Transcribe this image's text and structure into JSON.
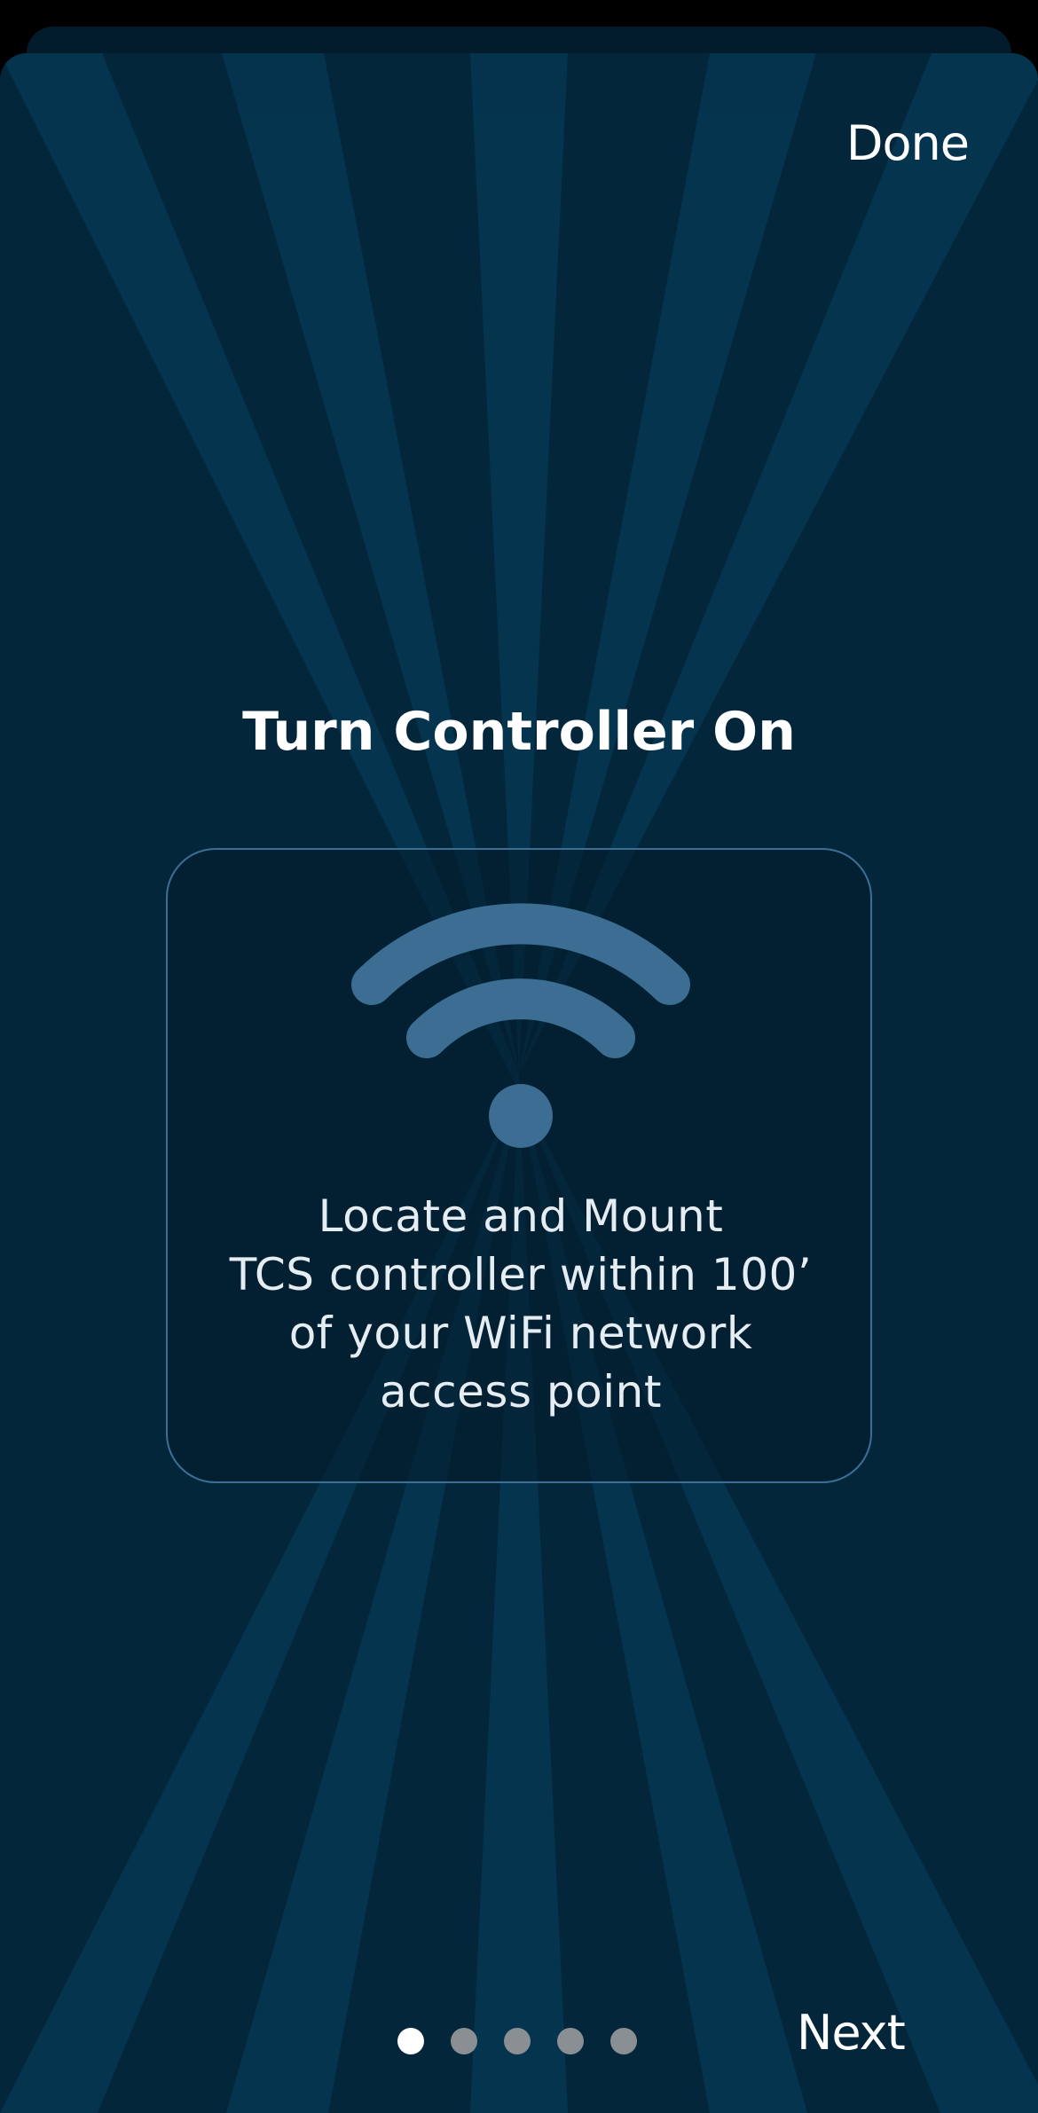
{
  "header": {
    "done_label": "Done"
  },
  "main": {
    "title": "Turn Controller On",
    "card": {
      "icon": "wifi-icon",
      "lines": [
        "Locate and Mount",
        "TCS controller within 100’",
        "of your WiFi network",
        "access point"
      ]
    }
  },
  "footer": {
    "page_count": 5,
    "current_page": 1,
    "next_label": "Next"
  },
  "colors": {
    "background": "#03263b",
    "ray": "#063651",
    "card_border": "#3d6f96",
    "icon": "#3b6e92",
    "dot_active": "#ffffff",
    "dot_inactive": "#8a8f94",
    "text": "#ffffff"
  }
}
